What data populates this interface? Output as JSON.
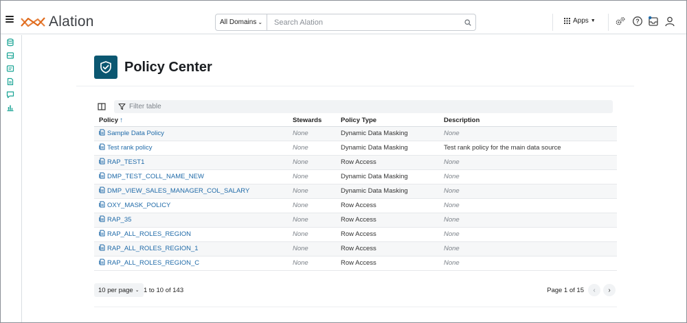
{
  "app": {
    "logo_text": "Alation"
  },
  "search": {
    "domain_label": "All Domains",
    "placeholder": "Search Alation"
  },
  "header_nav": {
    "apps_label": "Apps"
  },
  "colors": {
    "accent": "#1f6aa8",
    "header_badge": "#0b5771",
    "side_icons": "#18a394",
    "logo_orange": "#e06a1b"
  },
  "sidebar": {
    "items": [
      {
        "icon": "database-icon"
      },
      {
        "icon": "server-icon"
      },
      {
        "icon": "catalog-icon"
      },
      {
        "icon": "document-icon"
      },
      {
        "icon": "conversation-icon"
      },
      {
        "icon": "chart-icon"
      }
    ]
  },
  "page": {
    "title": "Policy Center"
  },
  "table": {
    "filter_placeholder": "Filter table",
    "columns": {
      "policy": "Policy",
      "stewards": "Stewards",
      "policy_type": "Policy Type",
      "description": "Description"
    },
    "sort_indicator": "↑",
    "rows": [
      {
        "policy": "Sample Data Policy",
        "stewards": "None",
        "policy_type": "Dynamic Data Masking",
        "description": "None"
      },
      {
        "policy": "Test rank policy",
        "stewards": "None",
        "policy_type": "Dynamic Data Masking",
        "description": "Test rank policy for the main data source"
      },
      {
        "policy": "RAP_TEST1",
        "stewards": "None",
        "policy_type": "Row Access",
        "description": "None"
      },
      {
        "policy": "DMP_TEST_COLL_NAME_NEW",
        "stewards": "None",
        "policy_type": "Dynamic Data Masking",
        "description": "None"
      },
      {
        "policy": "DMP_VIEW_SALES_MANAGER_COL_SALARY",
        "stewards": "None",
        "policy_type": "Dynamic Data Masking",
        "description": "None"
      },
      {
        "policy": "OXY_MASK_POLICY",
        "stewards": "None",
        "policy_type": "Row Access",
        "description": "None"
      },
      {
        "policy": "RAP_35",
        "stewards": "None",
        "policy_type": "Row Access",
        "description": "None"
      },
      {
        "policy": "RAP_ALL_ROLES_REGION",
        "stewards": "None",
        "policy_type": "Row Access",
        "description": "None"
      },
      {
        "policy": "RAP_ALL_ROLES_REGION_1",
        "stewards": "None",
        "policy_type": "Row Access",
        "description": "None"
      },
      {
        "policy": "RAP_ALL_ROLES_REGION_C",
        "stewards": "None",
        "policy_type": "Row Access",
        "description": "None"
      }
    ]
  },
  "pagination": {
    "per_page": "10 per page",
    "range": "1 to 10 of 143",
    "page_info": "Page 1 of 15",
    "prev": "‹",
    "next": "›"
  }
}
